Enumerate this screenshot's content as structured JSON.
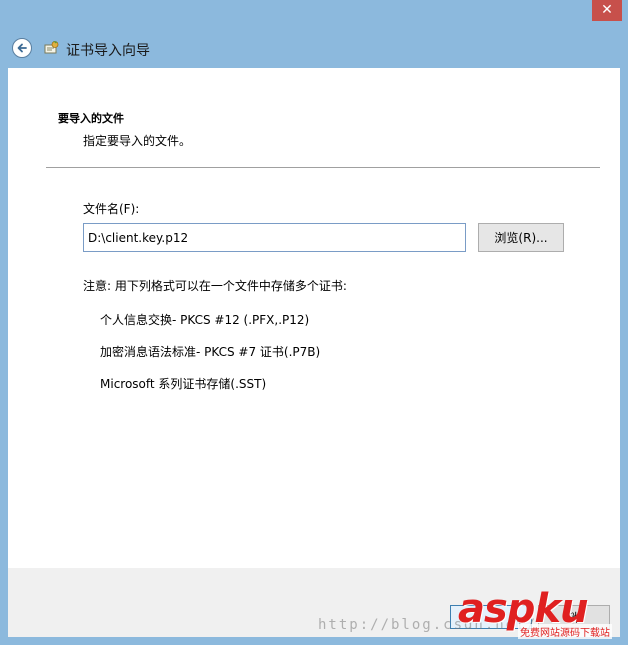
{
  "window": {
    "close_glyph": "✕"
  },
  "header": {
    "title": "证书导入向导"
  },
  "page": {
    "section_title": "要导入的文件",
    "section_desc": "指定要导入的文件。"
  },
  "file": {
    "label": "文件名(F):",
    "value": "D:\\client.key.p12",
    "browse_label": "浏览(R)..."
  },
  "note": {
    "text": "注意: 用下列格式可以在一个文件中存储多个证书:",
    "formats": [
      "个人信息交换- PKCS #12 (.PFX,.P12)",
      "加密消息语法标准- PKCS #7 证书(.P7B)",
      "Microsoft 系列证书存储(.SST)"
    ]
  },
  "footer": {
    "next_label": "",
    "cancel_label": "消"
  },
  "watermark": {
    "url": "http://blog.csdn.net/",
    "logo": "aspku",
    "logo_sub": "免费网站源码下载站"
  },
  "colors": {
    "accent": "#8cb9dd",
    "close": "#c7504b",
    "logo": "#e02020"
  }
}
